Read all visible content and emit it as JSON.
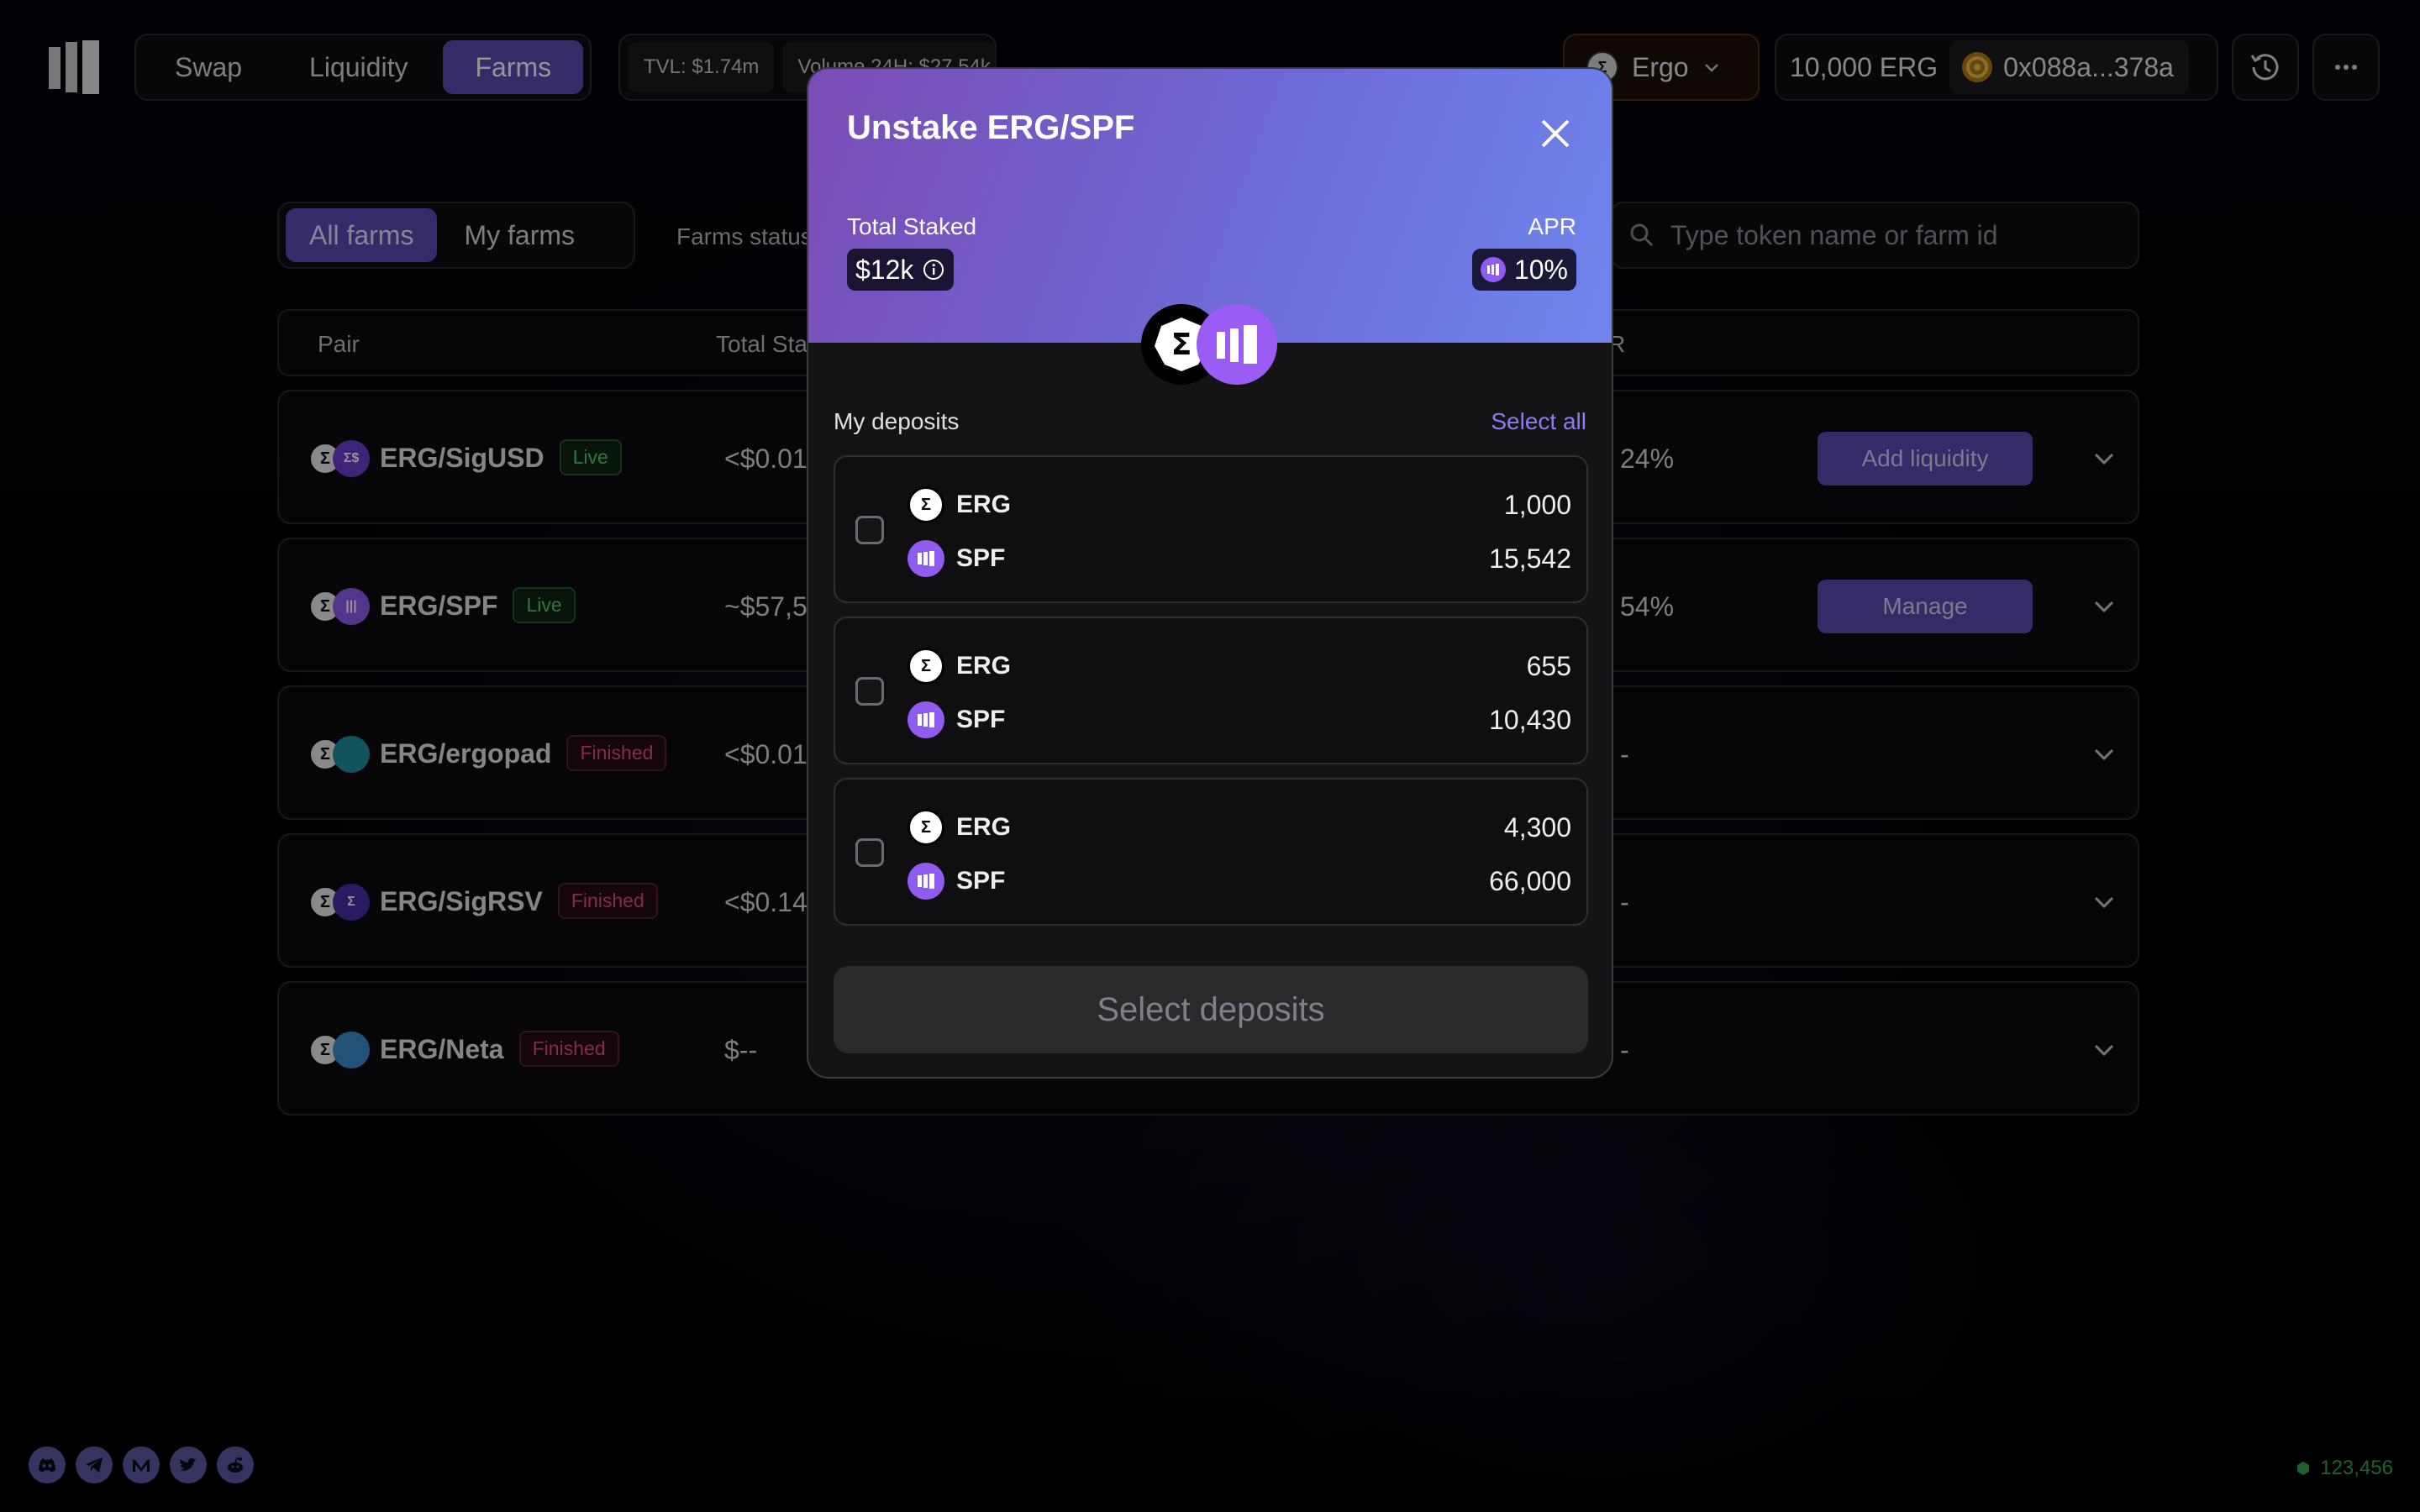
{
  "nav": {
    "tabs": [
      "Swap",
      "Liquidity",
      "Farms"
    ],
    "active": "Farms"
  },
  "stats": {
    "tvl": "TVL: $1.74m",
    "volume": "Volume 24H: $27.54k"
  },
  "network": {
    "name": "Ergo",
    "icon": "ergo-icon",
    "accent": "#c0461a"
  },
  "wallet": {
    "balance": "10,000 ERG",
    "address": "0x088a...378a"
  },
  "filters": {
    "tabs": [
      "All farms",
      "My farms"
    ],
    "active": "All farms",
    "status_label": "Farms status"
  },
  "search": {
    "placeholder": "Type token name or farm id"
  },
  "table": {
    "headers": {
      "pair": "Pair",
      "total_staked": "Total Sta",
      "apr": "R"
    },
    "rows": [
      {
        "pair": "ERG/SigUSD",
        "status": "Live",
        "total_staked": "<$0.01",
        "apr": "24%",
        "action": "Add liquidity",
        "icon": "sigusd-icon",
        "icon_color": "#6b3fd0",
        "icon_glyph": "Σ$"
      },
      {
        "pair": "ERG/SPF",
        "status": "Live",
        "total_staked": "~$57,5",
        "apr": "54%",
        "action": "Manage",
        "icon": "spf-icon",
        "icon_color": "#8f5cf0",
        "icon_glyph": "|||"
      },
      {
        "pair": "ERG/ergopad",
        "status": "Finished",
        "total_staked": "<$0.01",
        "apr": "-",
        "action": "",
        "icon": "ergopad-icon",
        "icon_color": "#1f8fa0",
        "icon_glyph": ""
      },
      {
        "pair": "ERG/SigRSV",
        "status": "Finished",
        "total_staked": "<$0.14",
        "apr": "-",
        "action": "",
        "icon": "sigrsv-icon",
        "icon_color": "#4b2ea8",
        "icon_glyph": "Σ"
      },
      {
        "pair": "ERG/Neta",
        "status": "Finished",
        "total_staked": "$--",
        "apr": "-",
        "action": "",
        "icon": "neta-icon",
        "icon_color": "#3a8fd0",
        "icon_glyph": ""
      }
    ]
  },
  "modal": {
    "title": "Unstake ERG/SPF",
    "total_staked_label": "Total Staked",
    "total_staked_value": "$12k",
    "apr_label": "APR",
    "apr_value": "10%",
    "deposits_label": "My deposits",
    "select_all": "Select all",
    "deposits": [
      {
        "erg": "1,000",
        "spf": "15,542"
      },
      {
        "erg": "655",
        "spf": "10,430"
      },
      {
        "erg": "4,300",
        "spf": "66,000"
      }
    ],
    "token_a": "ERG",
    "token_b": "SPF",
    "submit": "Select deposits"
  },
  "footer": {
    "block": "123,456",
    "socials": [
      "discord-icon",
      "telegram-icon",
      "medium-icon",
      "twitter-icon",
      "reddit-icon"
    ]
  },
  "colors": {
    "accent": "#5a4bb3",
    "live": "#4bd06a",
    "finished": "#e0507a"
  }
}
